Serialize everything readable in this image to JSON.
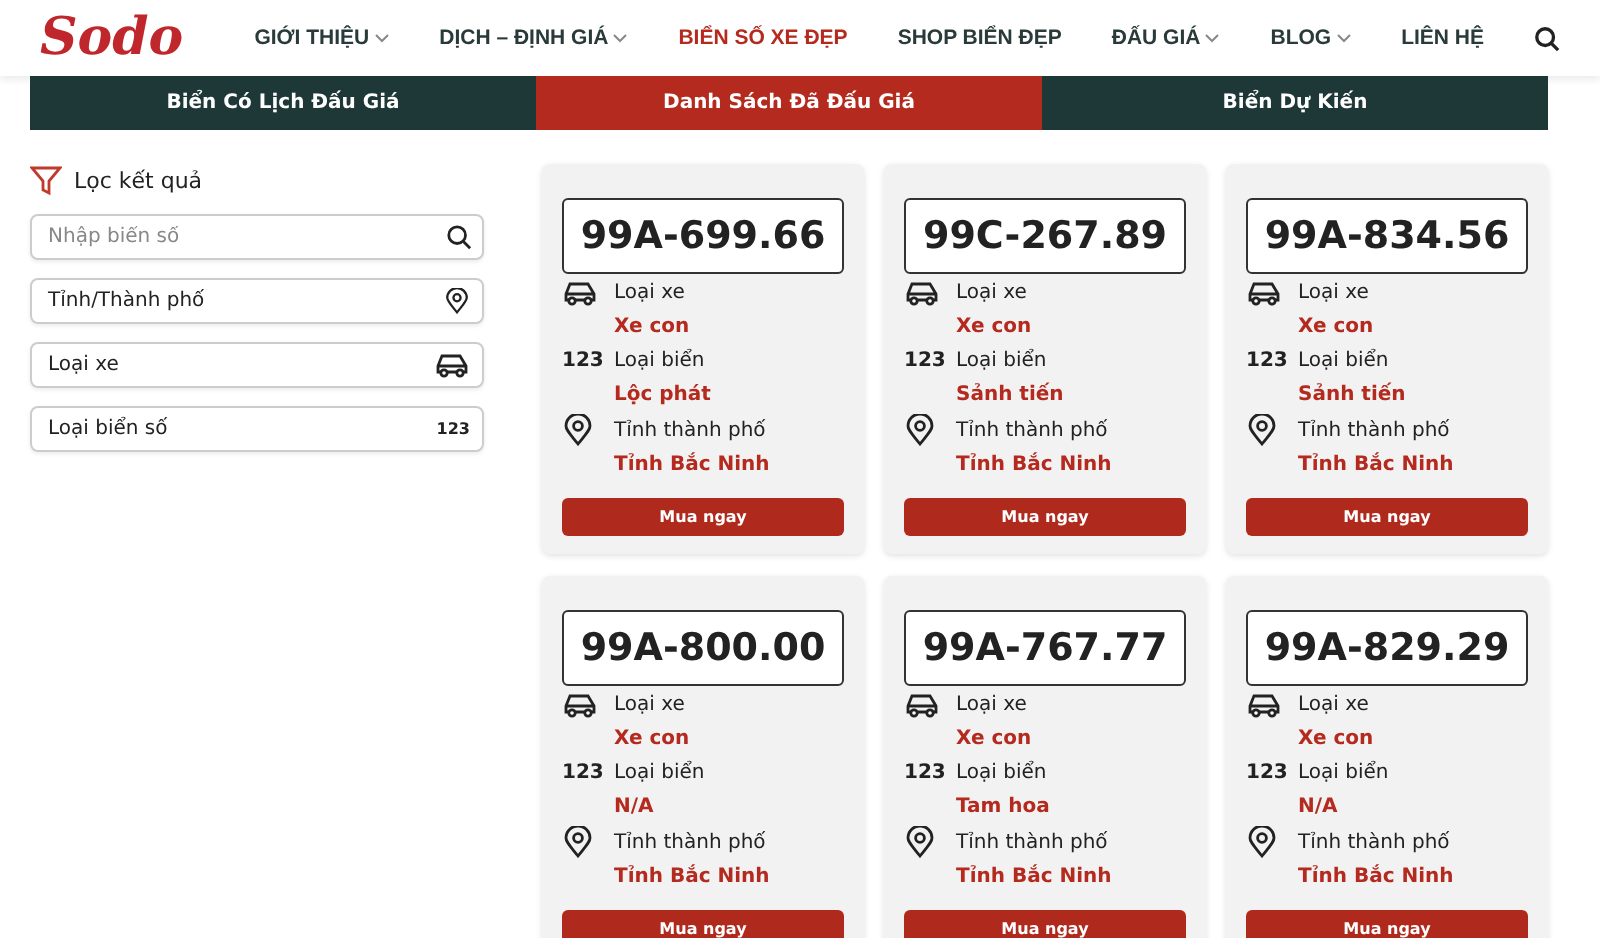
{
  "header": {
    "logo": "Sodo",
    "nav": [
      {
        "label": "GIỚI THIỆU",
        "dropdown": true,
        "selected": false
      },
      {
        "label": "DỊCH – ĐỊNH GIÁ",
        "dropdown": true,
        "selected": false
      },
      {
        "label": "BIỂN SỐ XE ĐẸP",
        "dropdown": false,
        "selected": true
      },
      {
        "label": "SHOP BIỂN ĐẸP",
        "dropdown": false,
        "selected": false
      },
      {
        "label": "ĐẤU GIÁ",
        "dropdown": true,
        "selected": false
      },
      {
        "label": "BLOG",
        "dropdown": true,
        "selected": false
      },
      {
        "label": "LIÊN HỆ",
        "dropdown": false,
        "selected": false
      }
    ]
  },
  "tabs": [
    {
      "label": "Biển Có Lịch Đấu Giá",
      "selected": false
    },
    {
      "label": "Danh Sách Đã Đấu Giá",
      "selected": true
    },
    {
      "label": "Biển Dự Kiến",
      "selected": false
    }
  ],
  "filter": {
    "title": "Lọc kết quả",
    "fields": [
      {
        "kind": "search",
        "placeholder": "Nhập biển số"
      },
      {
        "kind": "location",
        "value": "Tỉnh/Thành phố"
      },
      {
        "kind": "car",
        "value": "Loại xe"
      },
      {
        "kind": "number",
        "value": "Loại biển số",
        "icon_text": "123"
      }
    ]
  },
  "plates": [
    {
      "number": "99A-699.66",
      "vehicle_label": "Loại xe",
      "vehicle": "Xe con",
      "type_icon": "123",
      "type_label": "Loại biển",
      "type": "Lộc phát",
      "province_label": "Tỉnh thành phố",
      "province": "Tỉnh Bắc Ninh",
      "button": "Mua ngay"
    },
    {
      "number": "99C-267.89",
      "vehicle_label": "Loại xe",
      "vehicle": "Xe con",
      "type_icon": "123",
      "type_label": "Loại biển",
      "type": "Sảnh tiến",
      "province_label": "Tỉnh thành phố",
      "province": "Tỉnh Bắc Ninh",
      "button": "Mua ngay"
    },
    {
      "number": "99A-834.56",
      "vehicle_label": "Loại xe",
      "vehicle": "Xe con",
      "type_icon": "123",
      "type_label": "Loại biển",
      "type": "Sảnh tiến",
      "province_label": "Tỉnh thành phố",
      "province": "Tỉnh Bắc Ninh",
      "button": "Mua ngay"
    },
    {
      "number": "99A-800.00",
      "vehicle_label": "Loại xe",
      "vehicle": "Xe con",
      "type_icon": "123",
      "type_label": "Loại biển",
      "type": "N/A",
      "province_label": "Tỉnh thành phố",
      "province": "Tỉnh Bắc Ninh",
      "button": "Mua ngay"
    },
    {
      "number": "99A-767.77",
      "vehicle_label": "Loại xe",
      "vehicle": "Xe con",
      "type_icon": "123",
      "type_label": "Loại biển",
      "type": "Tam hoa",
      "province_label": "Tỉnh thành phố",
      "province": "Tỉnh Bắc Ninh",
      "button": "Mua ngay"
    },
    {
      "number": "99A-829.29",
      "vehicle_label": "Loại xe",
      "vehicle": "Xe con",
      "type_icon": "123",
      "type_label": "Loại biển",
      "type": "N/A",
      "province_label": "Tỉnh thành phố",
      "province": "Tỉnh Bắc Ninh",
      "button": "Mua ngay"
    }
  ]
}
